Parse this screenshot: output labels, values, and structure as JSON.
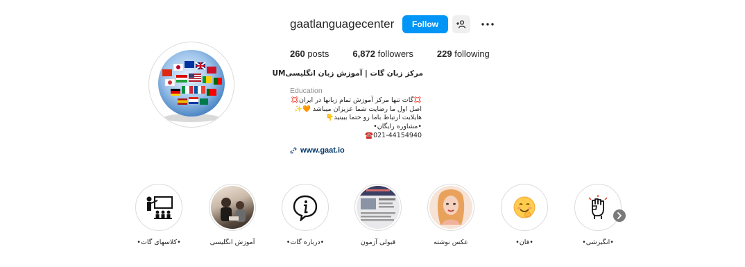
{
  "profile": {
    "username": "gaatlanguagecenter",
    "follow_label": "Follow",
    "suggest_icon": "person-plus-icon",
    "more_icon": "more-horizontal-icon",
    "stats": {
      "posts_count": "260",
      "posts_label": "posts",
      "followers_count": "6,872",
      "followers_label": "followers",
      "following_count": "229",
      "following_label": "following"
    },
    "bio_name": "مرکز زبان گات | آموزش زبان انگلیسیUM",
    "bio_name_um": "UM",
    "category": "Education",
    "bio_lines": [
      "💢گات تنها مرکز آموزش تمام زبانها در ایران💢",
      "اصل اول ما رضایت شما عزیزان میباشد 🧡✨",
      "هایلایت ارتباط باما رو حتما ببینید👇",
      "•مشاوره رایگان•",
      "021-44154940☎️"
    ],
    "website": "www.gaat.io",
    "accent_color": "#0095f6"
  },
  "highlights": [
    {
      "label": "•کلاسهای گات•",
      "icon": "classroom-teacher-icon"
    },
    {
      "label": "آموزش انگلیسی",
      "icon": "photo-thumbnail"
    },
    {
      "label": "•درباره گات•",
      "icon": "info-icon"
    },
    {
      "label": "قبولی آزمون",
      "icon": "document-thumbnail"
    },
    {
      "label": "عکس نوشته",
      "icon": "illustration-thumbnail"
    },
    {
      "label": "•فان•",
      "icon": "smiling-emoji-icon"
    },
    {
      "label": "•انگیزشی•",
      "icon": "raised-fist-icon"
    }
  ],
  "next_icon": "chevron-right-icon"
}
